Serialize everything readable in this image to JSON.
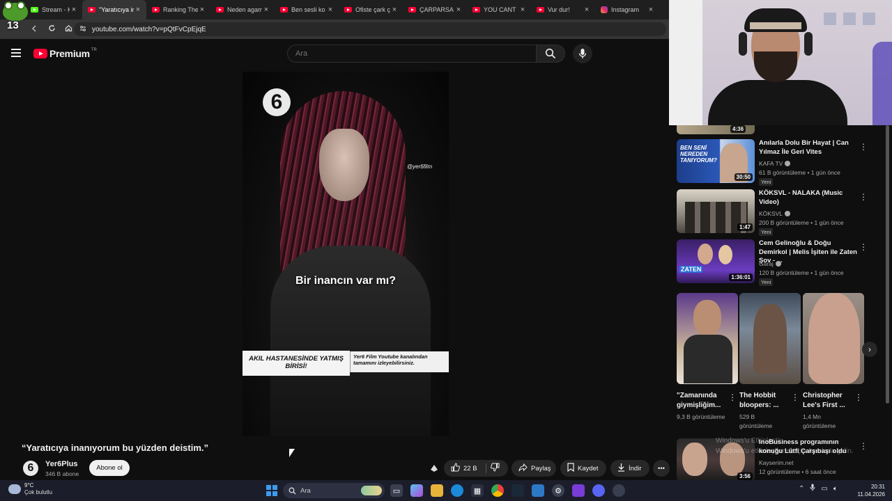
{
  "browser": {
    "tabs": [
      {
        "label": "Stream - Kic",
        "icon": "kick-icon"
      },
      {
        "label": "\"Yaratıcıya in",
        "icon": "youtube-icon",
        "active": true
      },
      {
        "label": "Ranking The",
        "icon": "youtube-icon"
      },
      {
        "label": "Neden agam",
        "icon": "youtube-icon"
      },
      {
        "label": "Ben sesli ko",
        "icon": "youtube-icon"
      },
      {
        "label": "Ofiste çark ç",
        "icon": "youtube-icon"
      },
      {
        "label": "ÇARPARSA F",
        "icon": "youtube-icon"
      },
      {
        "label": "YOU CANT",
        "icon": "youtube-icon"
      },
      {
        "label": "Vur dur!",
        "icon": "youtube-icon"
      },
      {
        "label": "Instagram",
        "icon": "instagram-icon"
      }
    ],
    "tab_counter": "13",
    "url": "youtube.com/watch?v=pQtFvCpEjqE"
  },
  "youtube": {
    "logo_text": "Premium",
    "region": "TR",
    "search_placeholder": "Ara"
  },
  "video": {
    "watermark": "@yer6film",
    "logo_glyph": "6",
    "caption": "Bir inancın var mı?",
    "banner_left": "AKIL HASTANESİNDE YATMIŞ BİRİSİ!",
    "banner_right": "Yer6 Film Youtube kanalından tamamını izleyebilirsiniz.",
    "title": "“Yaratıcıya inanıyorum bu yüzden deistim.”",
    "channel": {
      "name": "Yer6Plus",
      "subscribers": "346 B abone",
      "avatar_glyph": "6"
    },
    "subscribe_label": "Abone ol",
    "likes": "22 B",
    "share_label": "Paylaş",
    "save_label": "Kaydet",
    "download_label": "İndir"
  },
  "sidebar": {
    "top_partial_duration": "4:36",
    "recommendations": [
      {
        "title": "Anılarla Dolu Bir Hayat | Can Yılmaz İle Geri Vites",
        "channel": "KAFA TV",
        "meta": "61 B görüntüleme • 1 gün önce",
        "badge": "Yeni",
        "duration": "30:50",
        "thumb_text": "BEN SENİ NEREDEN TANIYORUM?"
      },
      {
        "title": "KÖKSVL - NALAKA (Music Video)",
        "channel": "KÖKSVL",
        "meta": "200 B görüntüleme • 1 gün önce",
        "badge": "Yeni",
        "duration": "1:47"
      },
      {
        "title": "Cem Gelinoğlu & Doğu Demirkol | Melis İşiten ile Zaten Şov - ...",
        "channel": "Garaj",
        "meta": "120 B görüntüleme • 1 gün önce",
        "badge": "Yeni",
        "duration": "1:36:01",
        "thumb_text": "ZATEN"
      },
      {
        "title": "InoBusiness programının konuğu Lütfi Çarşıbaşı oldu",
        "channel": "Kayserim.net",
        "meta": "12 görüntüleme • 6 saat önce",
        "duration": "3:56"
      }
    ],
    "shorts": [
      {
        "title": "\"Zamanında giymişliğim...",
        "views": "9,3 B görüntüleme"
      },
      {
        "title": "The Hobbit bloopers: ...",
        "views": "529 B görüntüleme"
      },
      {
        "title": "Christopher Lee's First ...",
        "views": "1,4 Mn görüntüleme"
      }
    ]
  },
  "overlay": {
    "activation_line1": "Windows'u Etkinleştir",
    "activation_line2": "Windows'u etkinleştirmek için Ayarlar'a gidin."
  },
  "taskbar": {
    "temperature": "9°C",
    "weather": "Çok bulutlu",
    "search_label": "Ara",
    "time": "20:31",
    "date": "11.04.2026"
  },
  "colors": {
    "accent": "#ff0033",
    "background": "#0f0f0f",
    "taskbar": "#1b1e2a"
  }
}
